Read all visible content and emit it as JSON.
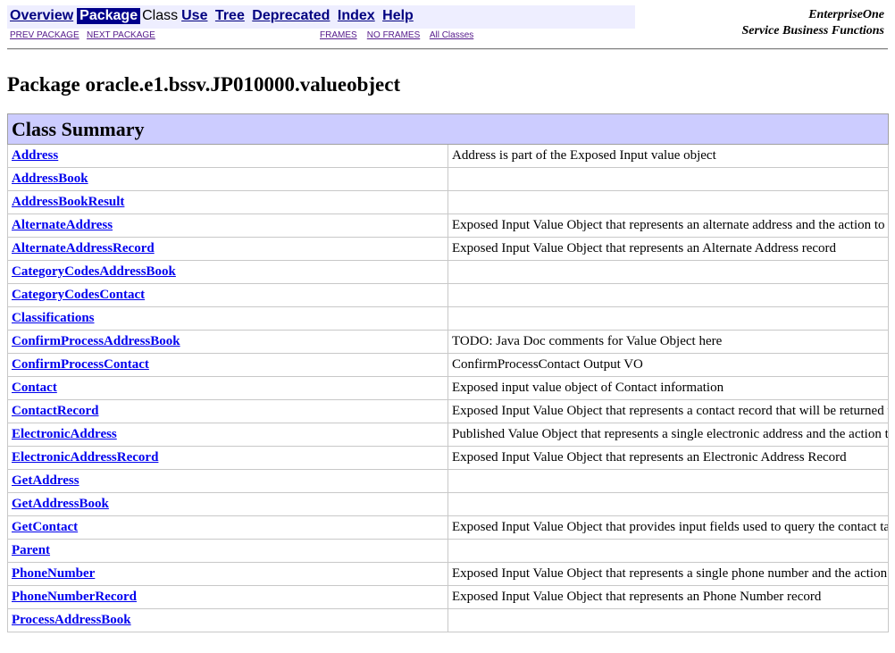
{
  "nav": {
    "overview": "Overview",
    "package": "Package",
    "class": "Class",
    "use": "Use",
    "tree": "Tree",
    "deprecated": "Deprecated",
    "index": "Index",
    "help": "Help",
    "prev_package": "PREV PACKAGE",
    "next_package": "NEXT PACKAGE",
    "frames": "FRAMES",
    "no_frames": "NO FRAMES",
    "all_classes": "All Classes"
  },
  "brand": {
    "line1": "EnterpriseOne",
    "line2": "Service Business Functions"
  },
  "page_title": "Package oracle.e1.bssv.JP010000.valueobject",
  "class_summary": {
    "header": "Class Summary",
    "rows": [
      {
        "name": "Address",
        "desc": "Address is part of the Exposed Input value object"
      },
      {
        "name": "AddressBook",
        "desc": ""
      },
      {
        "name": "AddressBookResult",
        "desc": ""
      },
      {
        "name": "AlternateAddress",
        "desc": "Exposed Input Value Object that represents an alternate address and the action to be peformed for it."
      },
      {
        "name": "AlternateAddressRecord",
        "desc": "Exposed Input Value Object that represents an Alternate Address record"
      },
      {
        "name": "CategoryCodesAddressBook",
        "desc": ""
      },
      {
        "name": "CategoryCodesContact",
        "desc": ""
      },
      {
        "name": "Classifications",
        "desc": ""
      },
      {
        "name": "ConfirmProcessAddressBook",
        "desc": "TODO: Java Doc comments for Value Object here"
      },
      {
        "name": "ConfirmProcessContact",
        "desc": "ConfirmProcessContact Output VO"
      },
      {
        "name": "Contact",
        "desc": "Exposed input value object of Contact information"
      },
      {
        "name": "ContactRecord",
        "desc": "Exposed Input Value Object that represents a contact record that will be returned to the consumer"
      },
      {
        "name": "ElectronicAddress",
        "desc": "Published Value Object that represents a single electronic address and the action to be performed on it."
      },
      {
        "name": "ElectronicAddressRecord",
        "desc": "Exposed Input Value Object that represents an Electronic Address Record"
      },
      {
        "name": "GetAddress",
        "desc": ""
      },
      {
        "name": "GetAddressBook",
        "desc": ""
      },
      {
        "name": "GetContact",
        "desc": "Exposed Input Value Object that provides input fields used to query the contact table."
      },
      {
        "name": "Parent",
        "desc": ""
      },
      {
        "name": "PhoneNumber",
        "desc": "Exposed Input Value Object that represents a single phone number and the action to be peformed for it."
      },
      {
        "name": "PhoneNumberRecord",
        "desc": "Exposed Input Value Object that represents an Phone Number record"
      },
      {
        "name": "ProcessAddressBook",
        "desc": ""
      }
    ]
  }
}
